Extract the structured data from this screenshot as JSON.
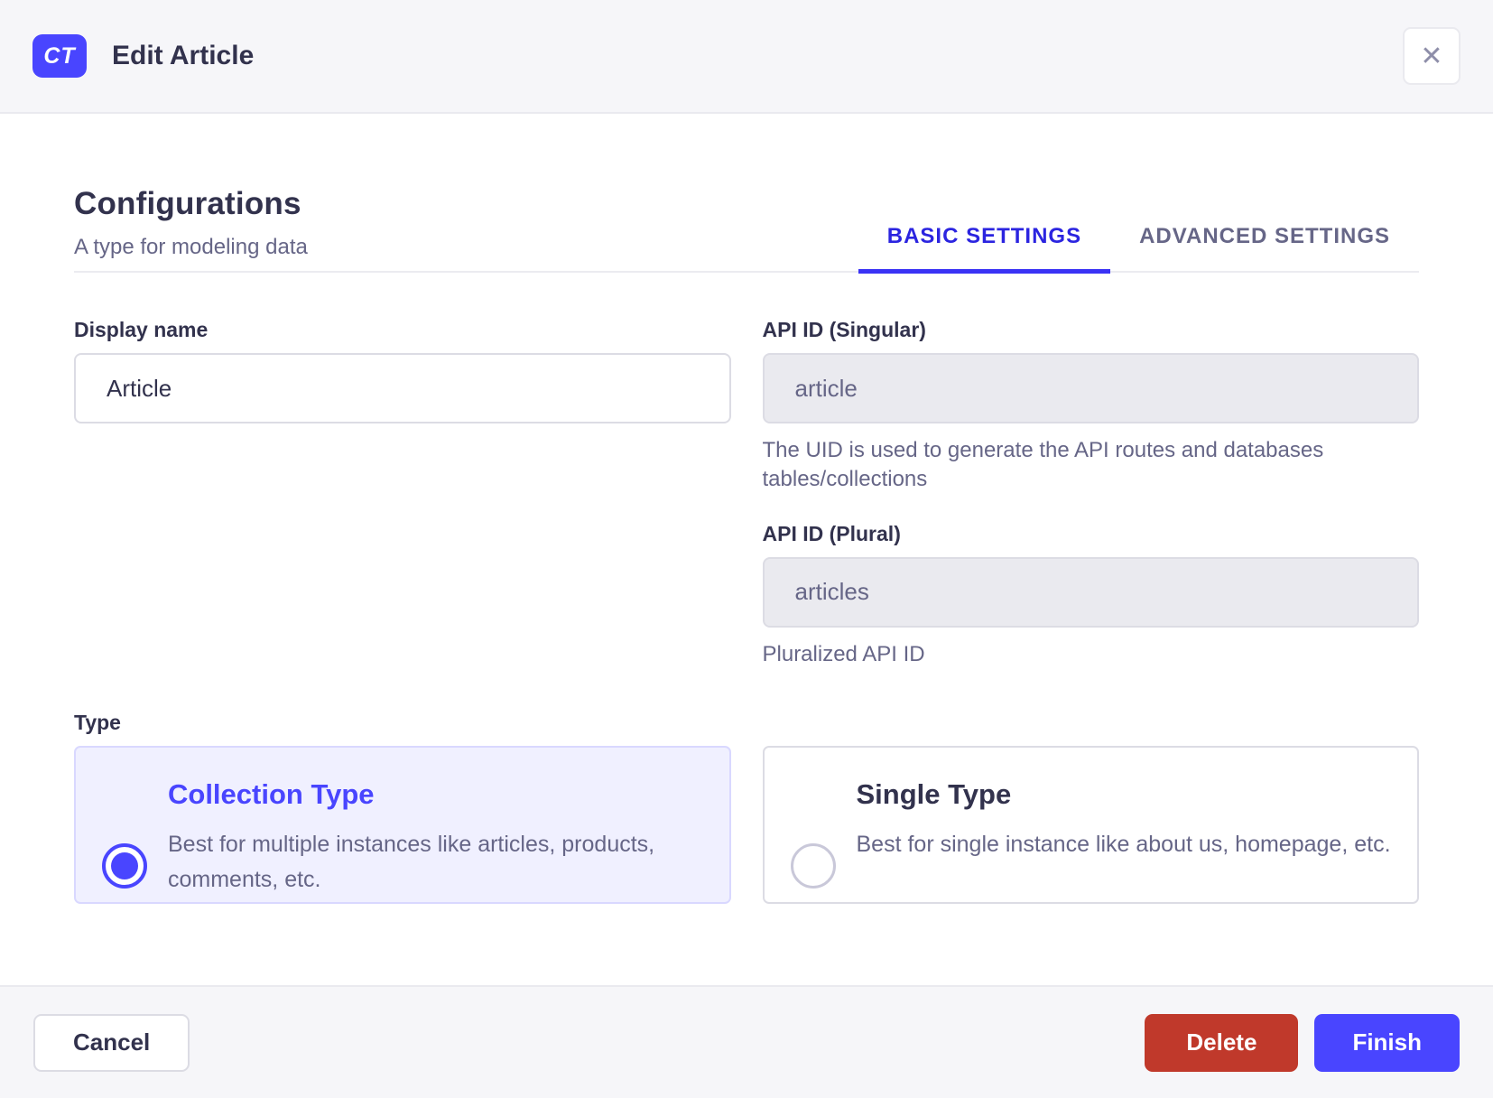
{
  "header": {
    "badge": "CT",
    "title": "Edit Article",
    "close_icon": "✕"
  },
  "configurations": {
    "title": "Configurations",
    "subtitle": "A type for modeling data"
  },
  "tabs": [
    {
      "label": "BASIC SETTINGS",
      "active": true
    },
    {
      "label": "ADVANCED SETTINGS",
      "active": false
    }
  ],
  "form": {
    "display_name": {
      "label": "Display name",
      "value": "Article"
    },
    "api_id_singular": {
      "label": "API ID (Singular)",
      "value": "article",
      "hint": "The UID is used to generate the API routes and databases tables/collections"
    },
    "api_id_plural": {
      "label": "API ID (Plural)",
      "value": "articles",
      "hint": "Pluralized API ID"
    },
    "type": {
      "label": "Type",
      "options": [
        {
          "title": "Collection Type",
          "description": "Best for multiple instances like articles, products, comments, etc.",
          "selected": true
        },
        {
          "title": "Single Type",
          "description": "Best for single instance like about us, homepage, etc.",
          "selected": false
        }
      ]
    }
  },
  "footer": {
    "cancel_label": "Cancel",
    "delete_label": "Delete",
    "finish_label": "Finish"
  },
  "colors": {
    "primary": "#4945ff",
    "tab_active": "#2b24e0",
    "danger": "#c0392b",
    "selected_card_bg": "#f0f0ff",
    "header_bg": "#f6f6f9",
    "text_dark": "#32324d",
    "text_muted": "#666687"
  }
}
